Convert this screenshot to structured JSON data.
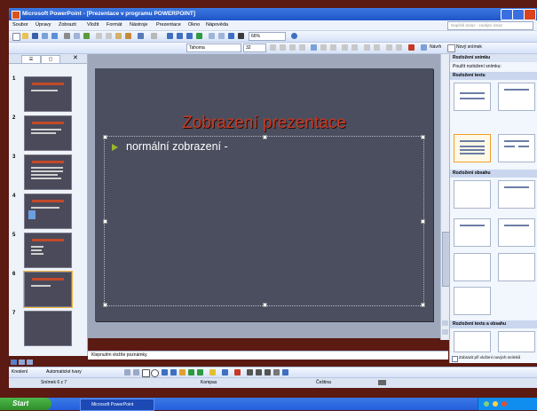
{
  "window": {
    "title": "Microsoft PowerPoint - [Prezentace v programu POWERPOINT]"
  },
  "menu": [
    "Soubor",
    "Úpravy",
    "Zobrazit",
    "Vložit",
    "Formát",
    "Nástroje",
    "Prezentace",
    "Okno",
    "Nápověda"
  ],
  "help_placeholder": "Napiště dotaz - zadejte dotaz",
  "toolbar": {
    "zoom": "66%",
    "font_name": "Tahoma",
    "font_size": "32",
    "new_slide_label": "Návrh",
    "new_slide_btn": "Nový snímek"
  },
  "slides_pane": {
    "tabs": [
      "Osnova",
      "Snímky"
    ],
    "thumbnails": [
      1,
      2,
      3,
      4,
      5,
      6,
      7
    ],
    "selected": 6
  },
  "slide": {
    "title": "Zobrazení prezentace",
    "bullet": "normální zobrazení -"
  },
  "notes_placeholder": "Klepnutím vložíte poznámky.",
  "task_pane": {
    "title": "Rozložení snímku",
    "apply_label": "Použít rozložení snímku:",
    "section_text": "Rozložení textu",
    "section_content": "Rozložení obsahu",
    "section_text_content": "Rozložení textu a obsahu",
    "show_on_insert": "Zobrazit při vložení nových snímků"
  },
  "draw_toolbar": {
    "draw_label": "Kreslení",
    "autoshapes_label": "Automatické tvary"
  },
  "status": {
    "slide_of": "Snímek 6 z 7",
    "design": "Kompas",
    "language": "Čeština"
  },
  "taskbar": {
    "start": "Start",
    "app": "Microsoft PowerPoint"
  }
}
